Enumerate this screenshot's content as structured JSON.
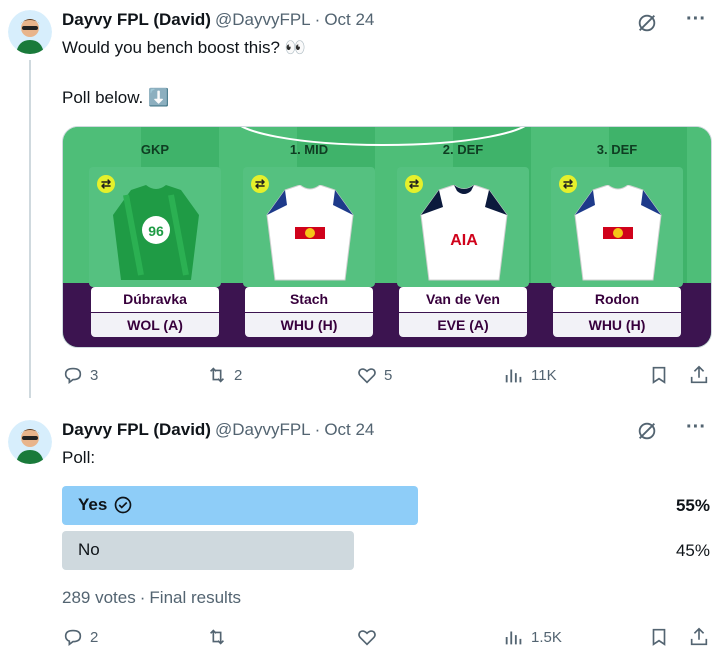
{
  "tweet1": {
    "author_name": "Dayvy FPL (David)",
    "handle": "@DayvyFPL",
    "date": "Oct 24",
    "line1": "Would you bench boost this? 👀",
    "line2": "Poll below. ⬇️",
    "actions": {
      "replies": "3",
      "retweets": "2",
      "likes": "5",
      "views": "11K"
    }
  },
  "fpl_card": {
    "players": [
      {
        "position": "GKP",
        "name": "Dúbravka",
        "fixture": "WOL (A)",
        "kit_color": "#1f9b45",
        "kit_text": "96"
      },
      {
        "position": "1. MID",
        "name": "Stach",
        "fixture": "WHU (H)",
        "kit_color": "#ffffff",
        "kit_text": ""
      },
      {
        "position": "2. DEF",
        "name": "Van de Ven",
        "fixture": "EVE (A)",
        "kit_color": "#ffffff",
        "kit_text": "AIA"
      },
      {
        "position": "3. DEF",
        "name": "Rodon",
        "fixture": "WHU (H)",
        "kit_color": "#ffffff",
        "kit_text": ""
      }
    ]
  },
  "tweet2": {
    "author_name": "Dayvy FPL (David)",
    "handle": "@DayvyFPL",
    "date": "Oct 24",
    "text": "Poll:",
    "poll": {
      "options": [
        {
          "label": "Yes",
          "percent": "55%",
          "fill": 0.55,
          "winner": true
        },
        {
          "label": "No",
          "percent": "45%",
          "fill": 0.45,
          "winner": false
        }
      ],
      "votes": "289 votes",
      "status": "Final results"
    },
    "actions": {
      "replies": "2",
      "views": "1.5K"
    }
  },
  "colors": {
    "accent": "#1d9bf0",
    "poll_winner": "#8ecdf8",
    "poll_loser": "#cfd9de"
  }
}
